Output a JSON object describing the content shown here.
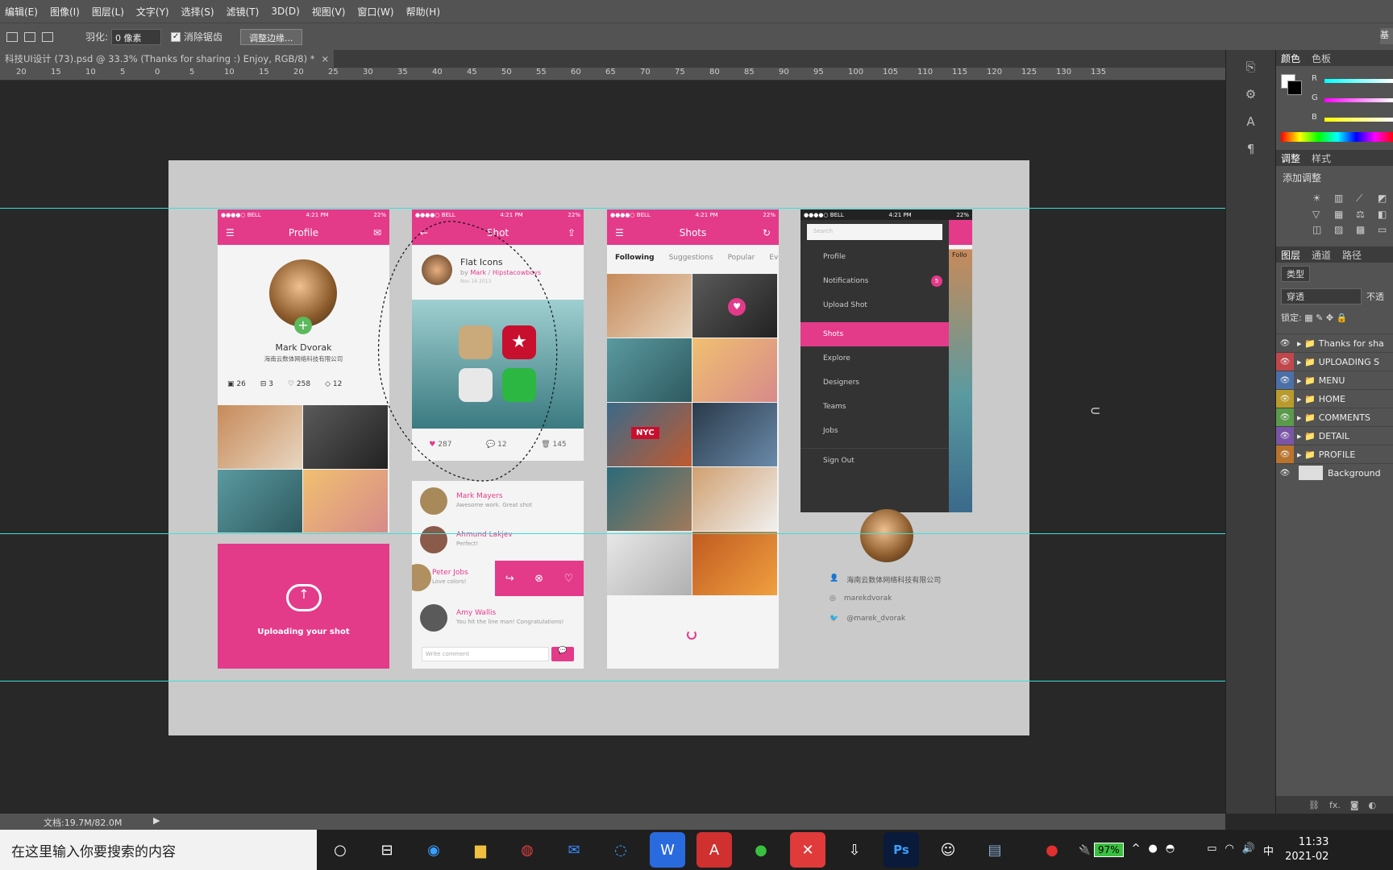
{
  "menu": [
    "编辑(E)",
    "图像(I)",
    "图层(L)",
    "文字(Y)",
    "选择(S)",
    "滤镜(T)",
    "3D(D)",
    "视图(V)",
    "窗口(W)",
    "帮助(H)"
  ],
  "options": {
    "feather_label": "羽化:",
    "feather_value": "0 像素",
    "antialias_label": "消除锯齿",
    "refine_button": "调整边缘..."
  },
  "doc_tab": {
    "title": "科技UI设计 (73).psd @ 33.3% (Thanks for sharing :) Enjoy, RGB/8) *",
    "close": "×"
  },
  "ruler": [
    "20",
    "15",
    "10",
    "5",
    "0",
    "5",
    "10",
    "15",
    "20",
    "25",
    "30",
    "35",
    "40",
    "45",
    "50",
    "55",
    "60",
    "65",
    "70",
    "75",
    "80",
    "85",
    "90",
    "95",
    "100",
    "105",
    "110",
    "115",
    "120",
    "125",
    "130",
    "135"
  ],
  "status": {
    "doc": "文档:19.7M/82.0M"
  },
  "mock": {
    "statusbar": {
      "carrier": "●●●●○ BELL",
      "time": "4:21 PM",
      "battery": "22%"
    },
    "profile": {
      "title": "Profile",
      "name": "Mark Dvorak",
      "company": "海南云数体网络科技有限公司",
      "stats": [
        "26",
        "3",
        "258",
        "12"
      ]
    },
    "upload": {
      "label": "Uploading your shot"
    },
    "shot": {
      "title": "Shot",
      "post_title": "Flat Icons",
      "post_by": "by",
      "post_author": "Mark",
      "post_team": "Hipstacowboys",
      "post_date": "Nov 16 2013",
      "likes": "287",
      "comments": "12",
      "buckets": "145",
      "comments_list": [
        {
          "name": "Mark Mayers",
          "text": "Awesome work. Great shot"
        },
        {
          "name": "Ahmund Lakjev",
          "text": "Perfect!"
        },
        {
          "name": "Peter Jobs",
          "text": "Love colors!"
        },
        {
          "name": "Amy Wallis",
          "text": "You hit the line man! Congratulations!"
        }
      ],
      "comment_placeholder": "Write comment"
    },
    "shots": {
      "title": "Shots",
      "tabs": [
        "Following",
        "Suggestions",
        "Popular",
        "Eve"
      ],
      "nyc": "NYC"
    },
    "menu": {
      "search": "Search",
      "items": [
        "Profile",
        "Notifications",
        "Upload Shot",
        "Shots",
        "Explore",
        "Designers",
        "Teams",
        "Jobs",
        "Sign Out"
      ],
      "badge": "5",
      "peek_tab": "Follo"
    },
    "contact": {
      "company": "海南云数体网络科技有限公司",
      "dribbble": "marekdvorak",
      "twitter": "@marek_dvorak"
    }
  },
  "panels": {
    "color_tabs": [
      "颜色",
      "色板"
    ],
    "rgb": [
      "R",
      "G",
      "B"
    ],
    "adjust_tabs": [
      "调整",
      "样式"
    ],
    "adjust_label": "添加调整",
    "layer_tabs": [
      "图层",
      "通道",
      "路径"
    ],
    "kind": "类型",
    "blend": "穿透",
    "opacity": "不透",
    "lock": "锁定:",
    "fx": "fx.",
    "layers": [
      {
        "name": "Thanks for sha",
        "color": "#535353"
      },
      {
        "name": "UPLOADING S",
        "color": "#c0474c"
      },
      {
        "name": "MENU",
        "color": "#4b70a8"
      },
      {
        "name": "HOME",
        "color": "#b99a2c"
      },
      {
        "name": "COMMENTS",
        "color": "#5a9a4b"
      },
      {
        "name": "DETAIL",
        "color": "#7a55a6"
      },
      {
        "name": "PROFILE",
        "color": "#b8742c"
      },
      {
        "name": "Background",
        "color": "#535353"
      }
    ]
  },
  "taskbar": {
    "search": "在这里输入你要搜索的内容",
    "battery": "97%",
    "ime": "中",
    "time": "11:33",
    "date": "2021-02"
  },
  "right_corner": "基"
}
